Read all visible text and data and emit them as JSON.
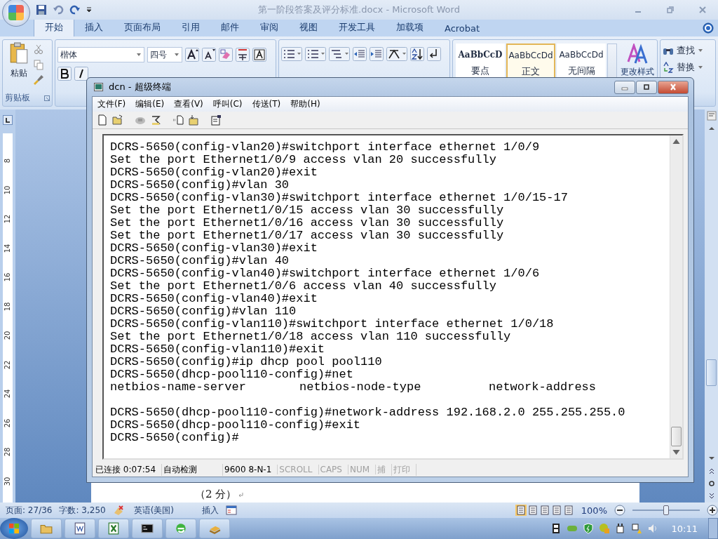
{
  "word": {
    "title": "第一阶段答案及评分标准.docx - Microsoft Word",
    "tabs": [
      {
        "label": "开始",
        "selected": true
      },
      {
        "label": "插入",
        "selected": false
      },
      {
        "label": "页面布局",
        "selected": false
      },
      {
        "label": "引用",
        "selected": false
      },
      {
        "label": "邮件",
        "selected": false
      },
      {
        "label": "审阅",
        "selected": false
      },
      {
        "label": "视图",
        "selected": false
      },
      {
        "label": "开发工具",
        "selected": false
      },
      {
        "label": "加载项",
        "selected": false
      },
      {
        "label": "Acrobat",
        "selected": false
      }
    ],
    "ribbon": {
      "paste": "粘贴",
      "clipboard_label": "剪贴板",
      "font_name": "楷体",
      "font_size": "四号",
      "styles": [
        {
          "preview": "AaBbCcD",
          "name": "要点",
          "kind": "bold",
          "selected": false
        },
        {
          "preview": "AaBbCcDd",
          "name": "正文",
          "kind": "plain",
          "selected": true
        },
        {
          "preview": "AaBbCcDd",
          "name": "无间隔",
          "kind": "plain",
          "selected": false
        }
      ],
      "change_styles": "更改样式",
      "editing": [
        {
          "label": "查找",
          "kind": "find"
        },
        {
          "label": "替换",
          "kind": "replace"
        }
      ]
    },
    "ruler_marks": [
      "8",
      "10",
      "12",
      "14",
      "16",
      "18",
      "20",
      "22",
      "24",
      "26",
      "28",
      "30"
    ],
    "document_text": "（2 分）",
    "status_bar": {
      "page": "页面: 27/36",
      "words": "字数: 3,250",
      "language": "英语(美国)",
      "mode": "插入",
      "zoom": "100%",
      "zoom_slider": {
        "level": 0.5
      },
      "views": [
        {
          "selected": true
        },
        {
          "selected": false
        },
        {
          "selected": false
        },
        {
          "selected": false
        },
        {
          "selected": false
        }
      ]
    }
  },
  "terminal": {
    "title": "dcn - 超级终端",
    "menu": [
      "文件(F)",
      "编辑(E)",
      "查看(V)",
      "呼叫(C)",
      "传送(T)",
      "帮助(H)"
    ],
    "lines": [
      {
        "text": "DCRS-5650(config-vlan20)#switchport interface ethernet 1/0/9"
      },
      {
        "text": "Set the port Ethernet1/0/9 access vlan 20 successfully"
      },
      {
        "text": "DCRS-5650(config-vlan20)#exit"
      },
      {
        "text": "DCRS-5650(config)#vlan 30"
      },
      {
        "text": "DCRS-5650(config-vlan30)#switchport interface ethernet 1/0/15-17"
      },
      {
        "text": "Set the port Ethernet1/0/15 access vlan 30 successfully"
      },
      {
        "text": "Set the port Ethernet1/0/16 access vlan 30 successfully"
      },
      {
        "text": "Set the port Ethernet1/0/17 access vlan 30 successfully"
      },
      {
        "text": "DCRS-5650(config-vlan30)#exit"
      },
      {
        "text": "DCRS-5650(config)#vlan 40"
      },
      {
        "text": "DCRS-5650(config-vlan40)#switchport interface ethernet 1/0/6"
      },
      {
        "text": "Set the port Ethernet1/0/6 access vlan 40 successfully"
      },
      {
        "text": "DCRS-5650(config-vlan40)#exit"
      },
      {
        "text": "DCRS-5650(config)#vlan 110"
      },
      {
        "text": "DCRS-5650(config-vlan110)#switchport interface ethernet 1/0/18"
      },
      {
        "text": "Set the port Ethernet1/0/18 access vlan 110 successfully"
      },
      {
        "text": "DCRS-5650(config-vlan110)#exit"
      },
      {
        "text": "DCRS-5650(config)#ip dhcp pool pool110"
      },
      {
        "text": "DCRS-5650(dhcp-pool110-config)#net"
      },
      {
        "kind": "completion",
        "options": [
          "netbios-name-server",
          "netbios-node-type",
          "network-address"
        ]
      },
      {
        "text": "DCRS-5650(dhcp-pool110-config)#network-address 192.168.2.0 255.255.255.0"
      },
      {
        "text": "DCRS-5650(dhcp-pool110-config)#exit"
      },
      {
        "text": "DCRS-5650(config)#"
      }
    ],
    "status": [
      {
        "text": "已连接 0:07:54",
        "disabled": false
      },
      {
        "text": "自动检测",
        "disabled": false
      },
      {
        "text": "9600 8-N-1",
        "disabled": false
      },
      {
        "text": "SCROLL",
        "disabled": true
      },
      {
        "text": "CAPS",
        "disabled": true
      },
      {
        "text": "NUM",
        "disabled": true
      },
      {
        "text": "捕",
        "disabled": true
      },
      {
        "text": "打印",
        "disabled": true
      }
    ]
  },
  "taskbar": {
    "clock": "10:11"
  }
}
